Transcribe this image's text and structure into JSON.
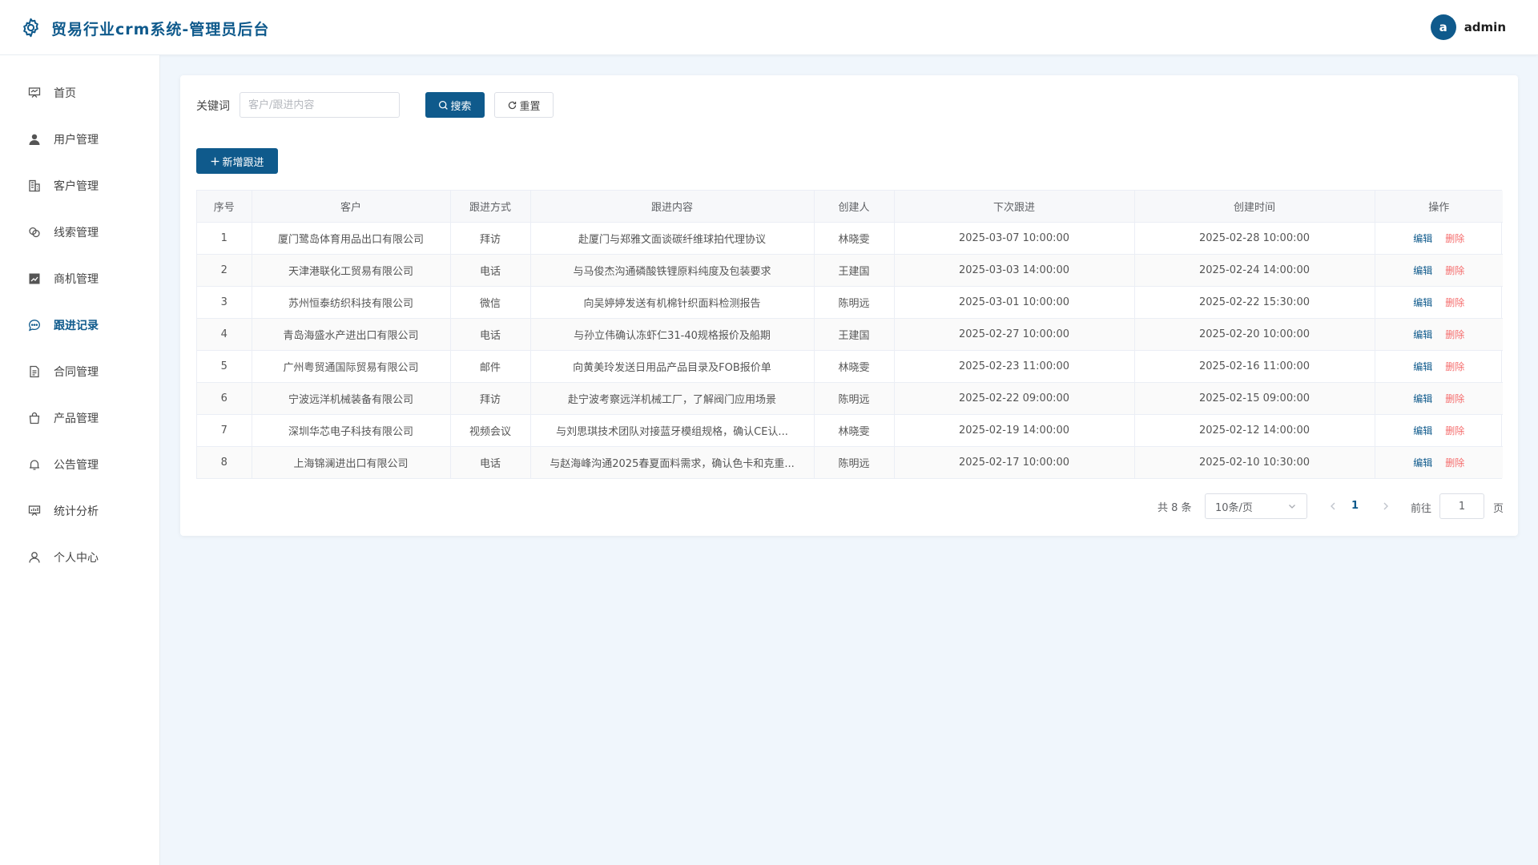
{
  "header": {
    "title": "贸易行业crm系统-管理员后台",
    "user_initial": "a",
    "username": "admin"
  },
  "sidebar": {
    "items": [
      {
        "label": "首页",
        "icon": "presentation-icon"
      },
      {
        "label": "用户管理",
        "icon": "user-icon"
      },
      {
        "label": "客户管理",
        "icon": "building-icon"
      },
      {
        "label": "线索管理",
        "icon": "link-icon"
      },
      {
        "label": "商机管理",
        "icon": "trend-chart-icon"
      },
      {
        "label": "跟进记录",
        "icon": "chat-icon",
        "active": true
      },
      {
        "label": "合同管理",
        "icon": "document-icon"
      },
      {
        "label": "产品管理",
        "icon": "shopping-bag-icon"
      },
      {
        "label": "公告管理",
        "icon": "bell-icon"
      },
      {
        "label": "统计分析",
        "icon": "data-board-icon"
      },
      {
        "label": "个人中心",
        "icon": "user-outline-icon"
      }
    ]
  },
  "search": {
    "label": "关键词",
    "placeholder": "客户/跟进内容",
    "value": "",
    "search_label": "搜索",
    "reset_label": "重置",
    "add_label": "新增跟进"
  },
  "table": {
    "columns": [
      "序号",
      "客户",
      "跟进方式",
      "跟进内容",
      "创建人",
      "下次跟进",
      "创建时间",
      "操作"
    ],
    "rows": [
      [
        "1",
        "厦门鹭岛体育用品出口有限公司",
        "拜访",
        "赴厦门与郑雅文面谈碳纤维球拍代理协议",
        "林晓雯",
        "2025-03-07 10:00:00",
        "2025-02-28 10:00:00"
      ],
      [
        "2",
        "天津港联化工贸易有限公司",
        "电话",
        "与马俊杰沟通磷酸铁锂原料纯度及包装要求",
        "王建国",
        "2025-03-03 14:00:00",
        "2025-02-24 14:00:00"
      ],
      [
        "3",
        "苏州恒泰纺织科技有限公司",
        "微信",
        "向吴婷婷发送有机棉针织面料检测报告",
        "陈明远",
        "2025-03-01 10:00:00",
        "2025-02-22 15:30:00"
      ],
      [
        "4",
        "青岛海盛水产进出口有限公司",
        "电话",
        "与孙立伟确认冻虾仁31-40规格报价及船期",
        "王建国",
        "2025-02-27 10:00:00",
        "2025-02-20 10:00:00"
      ],
      [
        "5",
        "广州粤贸通国际贸易有限公司",
        "邮件",
        "向黄美玲发送日用品产品目录及FOB报价单",
        "林晓雯",
        "2025-02-23 11:00:00",
        "2025-02-16 11:00:00"
      ],
      [
        "6",
        "宁波远洋机械装备有限公司",
        "拜访",
        "赴宁波考察远洋机械工厂，了解阀门应用场景",
        "陈明远",
        "2025-02-22 09:00:00",
        "2025-02-15 09:00:00"
      ],
      [
        "7",
        "深圳华芯电子科技有限公司",
        "视频会议",
        "与刘思琪技术团队对接蓝牙模组规格，确认CE认...",
        "林晓雯",
        "2025-02-19 14:00:00",
        "2025-02-12 14:00:00"
      ],
      [
        "8",
        "上海锦澜进出口有限公司",
        "电话",
        "与赵海峰沟通2025春夏面料需求，确认色卡和克重...",
        "陈明远",
        "2025-02-17 10:00:00",
        "2025-02-10 10:30:00"
      ]
    ],
    "edit_label": "编辑",
    "delete_label": "删除"
  },
  "pagination": {
    "total_text": "共 8 条",
    "page_size": "10条/页",
    "current_page": "1",
    "goto_label": "前往",
    "goto_value": "1",
    "goto_suffix": "页"
  },
  "colors": {
    "primary": "#0f5a8c",
    "danger": "#f56c6c",
    "background": "#f0f6fc"
  }
}
